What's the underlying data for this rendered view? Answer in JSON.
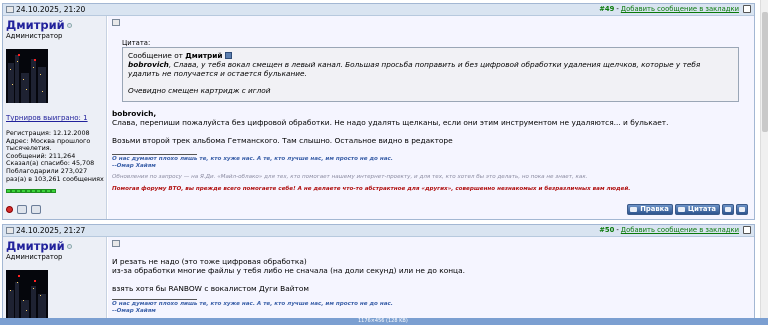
{
  "posts": [
    {
      "date": "24.10.2025, 21:20",
      "number": "#49",
      "separator": " - ",
      "bookmark_link": "Добавить сообщение в закладки",
      "username": "Дмитрий",
      "role": "Администратор",
      "tournaments": "Турниров выиграно: 1",
      "info": [
        "Регистрация: 12.12.2008",
        "Адрес: Москва прошлого тысячелетия.",
        "Сообщений: 211,264",
        "Сказал(а) спасибо: 45,708",
        "Поблагодарили 273,027",
        "раз(а) в 103,261 сообщениях"
      ],
      "quote_label": "Цитата:",
      "quote_from_prefix": "Сообщение от ",
      "quote_from_user": "Дмитрий",
      "quote_body_user": "bobrovich",
      "quote_body_text": ", Слава, у тебя вокал смещен в левый канал. Большая просьба поправить и без цифровой обработки удаления щелчков, которые у тебя удалить не получается и остается булькание.",
      "quote_footer": "Очевидно смещен картридж с иглой",
      "reply_user": "bobrovich",
      "reply_lines": [
        "Слава, перепиши пожалуйста без цифровой обработки. Не надо удалять щелканы, если они этим инструментом не удаляются... и булькает.",
        "Возьми второй трек альбома Гетманского. Там слышно. Остальное видно в редакторе"
      ],
      "signature": [
        "О нас думают плохо лишь те, кто хуже нас. А те, кто лучше нас, им просто не до нас.",
        "--Омар Хайям"
      ],
      "signature_grey": "Обновления по запросу — на Я.Ди. «Майл-облако» для тех, кто помогает нашему интернет-проекту, и для тех, кто хотел бы это делать, но пока не знает, как.",
      "signature_red": "Помогая форуму ВТО, вы прежде всего помогаете себе! А не делаете что-то абстрактное для «других», совершенно незнакомых и безразличных вам людей.",
      "btn_edit": "Правка",
      "btn_quote": "Цитата"
    },
    {
      "date": "24.10.2025, 21:27",
      "number": "#50",
      "separator": " - ",
      "bookmark_link": "Добавить сообщение в закладки",
      "username": "Дмитрий",
      "role": "Администратор",
      "lines": [
        "И резать не надо (это тоже цифровая обработка)",
        "из-за обработки многие файлы у тебя либо не сначала (на доли секунд) или не до конца.",
        "взять хотя бы RANBOW с вокалистом Дуги Вайтом"
      ],
      "signature": [
        "О нас думают плохо лишь те, кто хуже нас. А те, кто лучше нас, им просто не до нас.",
        "--Омар Хайям"
      ]
    }
  ],
  "status_dims": "1176×456 (128 KB)",
  "colors": {
    "header_bg": "#d9e4f1",
    "username": "#22229c",
    "link_green": "#0b7a0b",
    "signature_blue": "#3a5fa8",
    "signature_red": "#b01010"
  },
  "icons": [
    "post-icon",
    "online-status-icon",
    "offline-status-icon",
    "jump-to-quote-icon",
    "edit-icon",
    "quote-icon",
    "multiquote-icon",
    "quick-reply-icon"
  ]
}
